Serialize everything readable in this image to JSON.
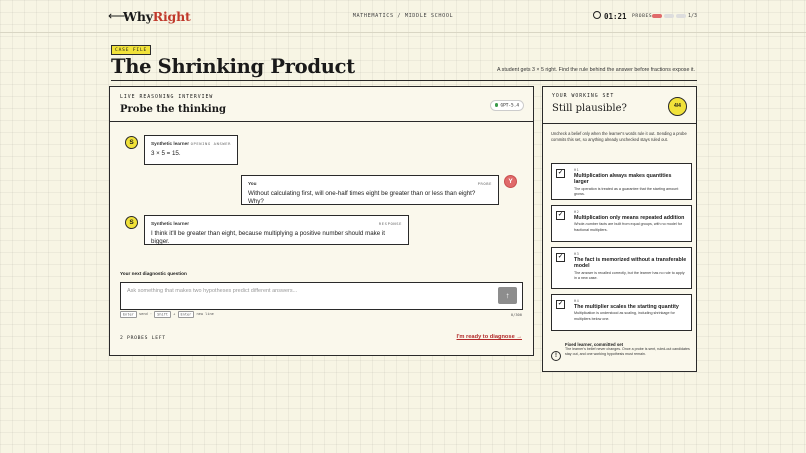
{
  "topbar": {
    "back": "⟵",
    "logo_a": "Why",
    "logo_b": "Right",
    "breadcrumb": "Mathematics  /  Middle School",
    "timer": "01:21",
    "probes_label": "PROBES",
    "probes_count": "1/3",
    "probes_used": 1,
    "probes_total": 3
  },
  "case": {
    "tag": "CASE FILE",
    "title": "The Shrinking Product",
    "subtitle": "A student gets 3 × 5 right. Find the rule behind the answer before fractions expose it."
  },
  "interview": {
    "label": "LIVE REASONING INTERVIEW",
    "title": "Probe the thinking",
    "model": "GPT-5.4",
    "messages": [
      {
        "avatar": "S",
        "author": "Synthetic learner",
        "tag": "OPENING ANSWER",
        "text": "3 × 5 = 15."
      },
      {
        "avatar": "Y",
        "author": "You",
        "tag": "PROBE",
        "text": "Without calculating first, will one-half times eight be greater than or less than eight? Why?"
      },
      {
        "avatar": "S",
        "author": "Synthetic learner",
        "tag": "RESPONSE",
        "text": "I think it'll be greater than eight, because multiplying a positive number should make it bigger."
      }
    ],
    "next_label": "Your next diagnostic question",
    "placeholder": "Ask something that makes two hypotheses predict different answers...",
    "send_icon": "↑",
    "key_enter": "Enter",
    "key_enter_text": "send ·",
    "key_shift": "Shift",
    "key_plus": "+",
    "key_enter2": "Enter",
    "key_newline_text": "new line",
    "char_count": "0/300",
    "probes_left": "2 PROBES LEFT",
    "ready": "I'm ready to diagnose →"
  },
  "working_set": {
    "label": "YOUR WORKING SET",
    "title": "Still plausible?",
    "badge": "4/4",
    "intro": "Uncheck a belief only when the learner's words rule it out. Sending a probe commits this set, so anything already unchecked stays ruled out.",
    "hypotheses": [
      {
        "num": "H1",
        "checked": true,
        "title": "Multiplication always makes quantities larger",
        "desc": "The operation is treated as a guarantee that the starting amount grows."
      },
      {
        "num": "H2",
        "checked": true,
        "title": "Multiplication only means repeated addition",
        "desc": "Whole-number facts are built from equal groups, with no model for fractional multipliers."
      },
      {
        "num": "H3",
        "checked": true,
        "title": "The fact is memorized without a transferable model",
        "desc": "The answer is recalled correctly, but the learner has no rule to apply in a new case."
      },
      {
        "num": "H4",
        "checked": true,
        "title": "The multiplier scales the starting quantity",
        "desc": "Multiplication is understood as scaling, including shrinkage for multipliers below one."
      }
    ],
    "check_glyph": "✓",
    "fixed_icon": "!",
    "fixed_title": "Fixed learner, committed set",
    "fixed_desc": "The learner's belief never changes. Once a probe is sent, ruled-out candidates stay out, and one working hypothesis must remain."
  },
  "colors": {
    "accent_yellow": "#f1e23a",
    "accent_red": "#e06a6a",
    "link_red": "#b22a2a"
  }
}
